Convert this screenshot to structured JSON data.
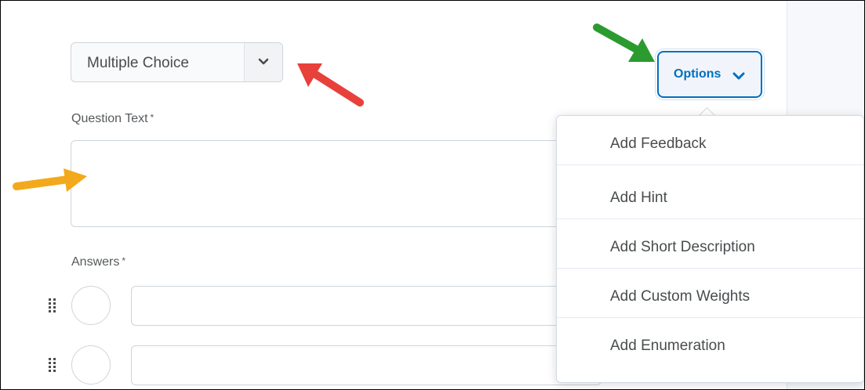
{
  "question_type": {
    "selected": "Multiple Choice"
  },
  "options_button": {
    "label": "Options"
  },
  "question_text": {
    "label": "Question Text",
    "required_mark": "*",
    "value": ""
  },
  "answers": {
    "label": "Answers",
    "required_mark": "*",
    "rows": [
      {
        "value": ""
      },
      {
        "value": ""
      }
    ]
  },
  "options_menu": {
    "items": [
      {
        "label": "Add Feedback"
      },
      {
        "label": "Add Hint"
      },
      {
        "label": "Add Short Description"
      },
      {
        "label": "Add Custom Weights"
      },
      {
        "label": "Add Enumeration"
      }
    ]
  },
  "colors": {
    "accent": "#006fbf",
    "annotation_red": "#e8403a",
    "annotation_green": "#2b9b2f",
    "annotation_orange": "#f2a91b"
  }
}
